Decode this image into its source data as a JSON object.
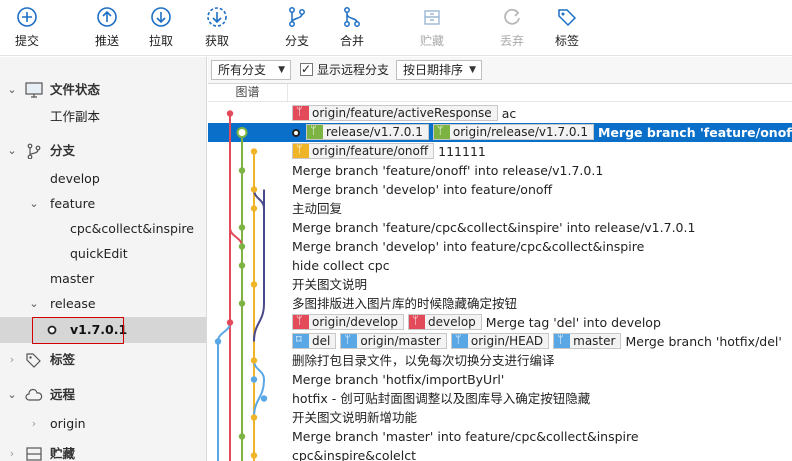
{
  "toolbar": {
    "items": [
      {
        "label": "提交",
        "icon": "plus-circle-icon"
      },
      {
        "label": "推送",
        "icon": "arrow-up-circle-icon"
      },
      {
        "label": "拉取",
        "icon": "arrow-down-circle-icon"
      },
      {
        "label": "获取",
        "icon": "arrow-down-dashed-circle-icon"
      },
      {
        "label": "分支",
        "icon": "branch-icon"
      },
      {
        "label": "合并",
        "icon": "merge-icon"
      },
      {
        "label": "贮藏",
        "icon": "stash-icon"
      },
      {
        "label": "丢弃",
        "icon": "discard-icon"
      },
      {
        "label": "标签",
        "icon": "tag-icon"
      }
    ]
  },
  "sidebar": {
    "file_status": {
      "label": "文件状态",
      "children": [
        "工作副本"
      ]
    },
    "branches": {
      "label": "分支",
      "children": [
        "develop",
        "feature",
        "cpc&collect&inspire",
        "quickEdit",
        "master",
        "release",
        "v1.7.0.1"
      ]
    },
    "tags": {
      "label": "标签"
    },
    "remotes": {
      "label": "远程",
      "children": [
        "origin"
      ]
    },
    "stashes": {
      "label": "贮藏"
    }
  },
  "filterbar": {
    "branch_filter": "所有分支",
    "show_remote_label": "显示远程分支",
    "show_remote_checked": true,
    "sort": "按日期排序"
  },
  "list": {
    "graph_header": "图谱",
    "rows": [
      {
        "tags": [
          {
            "color": "red",
            "text": "origin/feature/activeResponse"
          }
        ],
        "msg": "ac"
      },
      {
        "tags": [
          {
            "color": "green",
            "text": "release/v1.7.0.1"
          },
          {
            "color": "green",
            "text": "origin/release/v1.7.0.1"
          }
        ],
        "msg": "Merge branch 'feature/onoff' into"
      },
      {
        "tags": [
          {
            "color": "yellow",
            "text": "origin/feature/onoff"
          }
        ],
        "msg": "111111"
      },
      {
        "tags": [],
        "msg": "Merge branch 'feature/onoff' into release/v1.7.0.1"
      },
      {
        "tags": [],
        "msg": "Merge branch 'develop' into feature/onoff"
      },
      {
        "tags": [],
        "msg": "主动回复"
      },
      {
        "tags": [],
        "msg": "Merge branch 'feature/cpc&collect&inspire' into release/v1.7.0.1"
      },
      {
        "tags": [],
        "msg": "Merge branch 'develop' into feature/cpc&collect&inspire"
      },
      {
        "tags": [],
        "msg": "hide collect cpc"
      },
      {
        "tags": [],
        "msg": "开关图文说明"
      },
      {
        "tags": [],
        "msg": "多图排版进入图片库的时候隐藏确定按钮"
      },
      {
        "tags": [
          {
            "color": "red",
            "text": "origin/develop"
          },
          {
            "color": "red",
            "text": "develop"
          }
        ],
        "msg": "Merge tag 'del' into develop"
      },
      {
        "tags": [
          {
            "color": "blue-tag",
            "text": "del"
          },
          {
            "color": "blue",
            "text": "origin/master"
          },
          {
            "color": "blue",
            "text": "origin/HEAD"
          },
          {
            "color": "blue",
            "text": "master"
          }
        ],
        "msg": "Merge branch 'hotfix/del'"
      },
      {
        "tags": [],
        "msg": "删除打包目录文件，以免每次切换分支进行编译"
      },
      {
        "tags": [],
        "msg": "Merge branch 'hotfix/importByUrl'"
      },
      {
        "tags": [],
        "msg": "hotfix - 创可贴封面图调整以及图库导入确定按钮隐藏"
      },
      {
        "tags": [],
        "msg": "开关图文说明新增功能"
      },
      {
        "tags": [],
        "msg": "Merge branch 'master' into feature/cpc&collect&inspire"
      },
      {
        "tags": [],
        "msg": "cpc&inspire&colelct"
      }
    ]
  },
  "colors": {
    "selection": "#0a6fc9",
    "branch_red": "#e34b5a",
    "branch_green": "#7cb342",
    "branch_yellow": "#f0b429",
    "branch_blue": "#5aa7e6",
    "branch_purple": "#4a4a8a",
    "selected_outline": "#d40000"
  }
}
